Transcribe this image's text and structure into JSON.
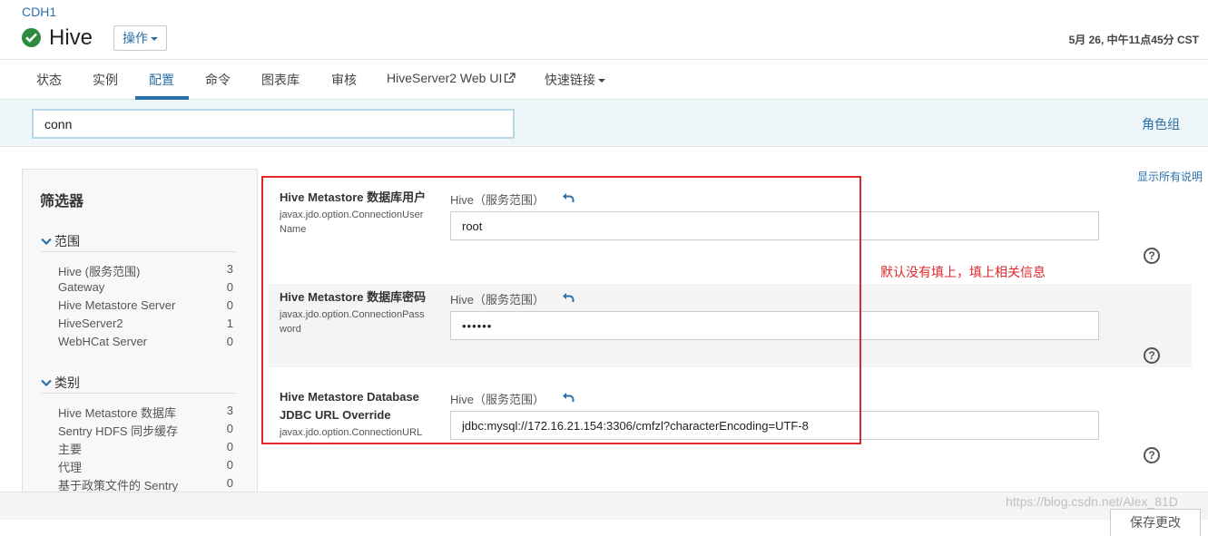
{
  "header": {
    "cluster": "CDH1",
    "service": "Hive",
    "actions_label": "操作",
    "timestamp": "5月 26, 中午11点45分 CST"
  },
  "tabs": [
    {
      "label": "状态"
    },
    {
      "label": "实例"
    },
    {
      "label": "配置"
    },
    {
      "label": "命令"
    },
    {
      "label": "图表库"
    },
    {
      "label": "审核"
    },
    {
      "label": "HiveServer2 Web UI"
    },
    {
      "label": "快速链接"
    }
  ],
  "search": {
    "value": "conn"
  },
  "role_groups_label": "角色组",
  "sidebar": {
    "title": "筛选器",
    "sections": [
      {
        "title": "范围",
        "items": [
          {
            "label": "Hive (服务范围)",
            "count": "3"
          },
          {
            "label": "Gateway",
            "count": "0"
          },
          {
            "label": "Hive Metastore Server",
            "count": "0"
          },
          {
            "label": "HiveServer2",
            "count": "1"
          },
          {
            "label": "WebHCat Server",
            "count": "0"
          }
        ]
      },
      {
        "title": "类别",
        "items": [
          {
            "label": "Hive Metastore 数据库",
            "count": "3"
          },
          {
            "label": "Sentry HDFS 同步缓存",
            "count": "0"
          },
          {
            "label": "主要",
            "count": "0"
          },
          {
            "label": "代理",
            "count": "0"
          },
          {
            "label": "基于政策文件的 Sentry",
            "count": "0"
          }
        ]
      }
    ]
  },
  "show_all_label": "显示所有说明",
  "configs": [
    {
      "name_lines": [
        "Hive Metastore 数据库用户"
      ],
      "key_lines": [
        "javax.jdo.option.ConnectionUser",
        "Name"
      ],
      "scope": "Hive（服务范围）",
      "value": "root"
    },
    {
      "name_lines": [
        "Hive Metastore 数据库密码"
      ],
      "key_lines": [
        "javax.jdo.option.ConnectionPass",
        "word"
      ],
      "scope": "Hive（服务范围）",
      "value": "••••••"
    },
    {
      "name_lines": [
        "Hive Metastore Database",
        "JDBC URL Override"
      ],
      "key_lines": [
        "javax.jdo.option.ConnectionURL"
      ],
      "scope": "Hive（服务范围）",
      "value": "jdbc:mysql://172.16.21.154:3306/cmfzl?characterEncoding=UTF-8"
    }
  ],
  "help_symbol": "?",
  "annotation": "默认没有填上，填上相关信息",
  "save_label": "保存更改",
  "watermark": "https://blog.csdn.net/Alex_81D",
  "colors": {
    "accent": "#2a6fa8",
    "success": "#2e8b3e",
    "annotation": "#e0282b"
  },
  "icons": [
    "check-circle-icon",
    "caret-down-icon",
    "external-link-icon",
    "chevron-down-icon",
    "undo-icon",
    "help-icon"
  ]
}
